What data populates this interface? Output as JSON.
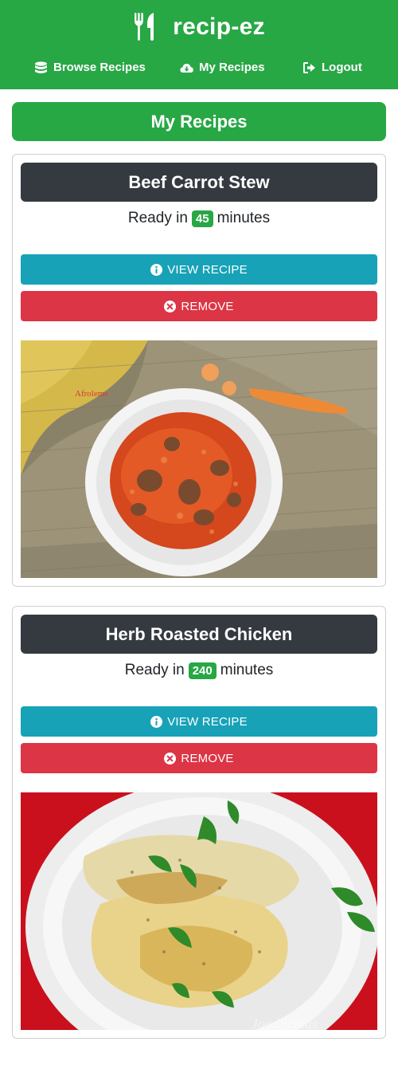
{
  "app": {
    "name": "recip-ez",
    "brand_icon": "utensils-icon",
    "brand_color": "#28a745"
  },
  "nav": {
    "items": [
      {
        "label": "Browse Recipes",
        "icon": "database-icon"
      },
      {
        "label": "My Recipes",
        "icon": "cloud-download-icon"
      },
      {
        "label": "Logout",
        "icon": "sign-out-icon"
      }
    ]
  },
  "page": {
    "title": "My Recipes"
  },
  "recipes": [
    {
      "title": "Beef Carrot Stew",
      "ready_prefix": "Ready in",
      "minutes": "45",
      "ready_suffix": "minutes",
      "view_label": "VIEW RECIPE",
      "remove_label": "REMOVE",
      "photo_caption": "Afrolems"
    },
    {
      "title": "Herb Roasted Chicken",
      "ready_prefix": "Ready in",
      "minutes": "240",
      "ready_suffix": "minutes",
      "view_label": "VIEW RECIPE",
      "remove_label": "REMOVE",
      "photo_caption": "Joodlicious"
    }
  ],
  "colors": {
    "header_bg": "#28a745",
    "card_title_bg": "#343a40",
    "view_button": "#17a2b8",
    "remove_button": "#dc3545",
    "badge": "#28a745"
  }
}
